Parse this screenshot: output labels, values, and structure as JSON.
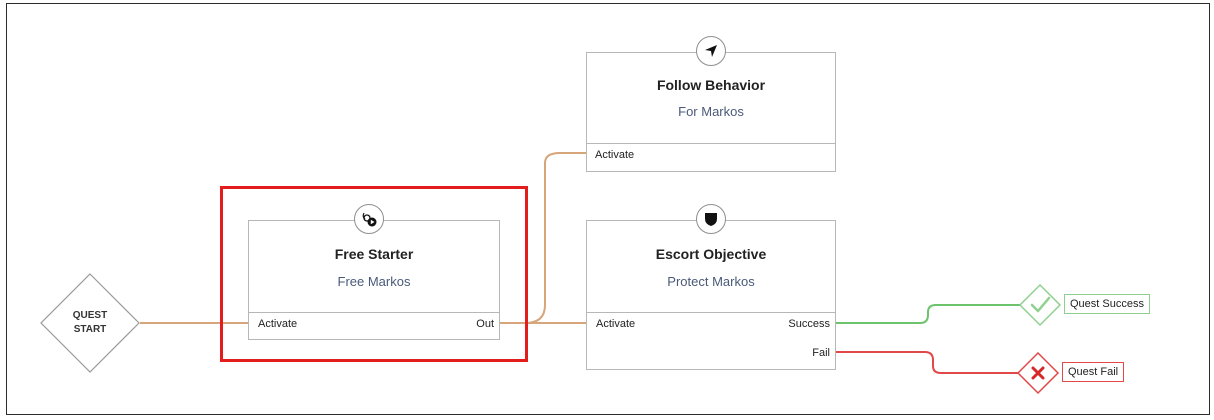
{
  "start": {
    "line1": "QUEST",
    "line2": "START"
  },
  "nodes": {
    "free_starter": {
      "title": "Free Starter",
      "subtitle": "Free Markos",
      "in_port": "Activate",
      "out_port": "Out",
      "icon": "unlock-play-icon"
    },
    "follow_behavior": {
      "title": "Follow Behavior",
      "subtitle": "For Markos",
      "in_port": "Activate",
      "icon": "navigation-arrow-icon"
    },
    "escort_objective": {
      "title": "Escort Objective",
      "subtitle": "Protect Markos",
      "in_port": "Activate",
      "success_port": "Success",
      "fail_port": "Fail",
      "icon": "shield-icon"
    }
  },
  "outcomes": {
    "success": {
      "label": "Quest Success",
      "icon": "checkmark-icon",
      "color": "#6cc36c"
    },
    "fail": {
      "label": "Quest Fail",
      "icon": "x-icon",
      "color": "#e14848"
    }
  },
  "colors": {
    "wire": "#d6a57a",
    "highlight": "#e31c1c",
    "subtitle": "#4a5a7a"
  }
}
